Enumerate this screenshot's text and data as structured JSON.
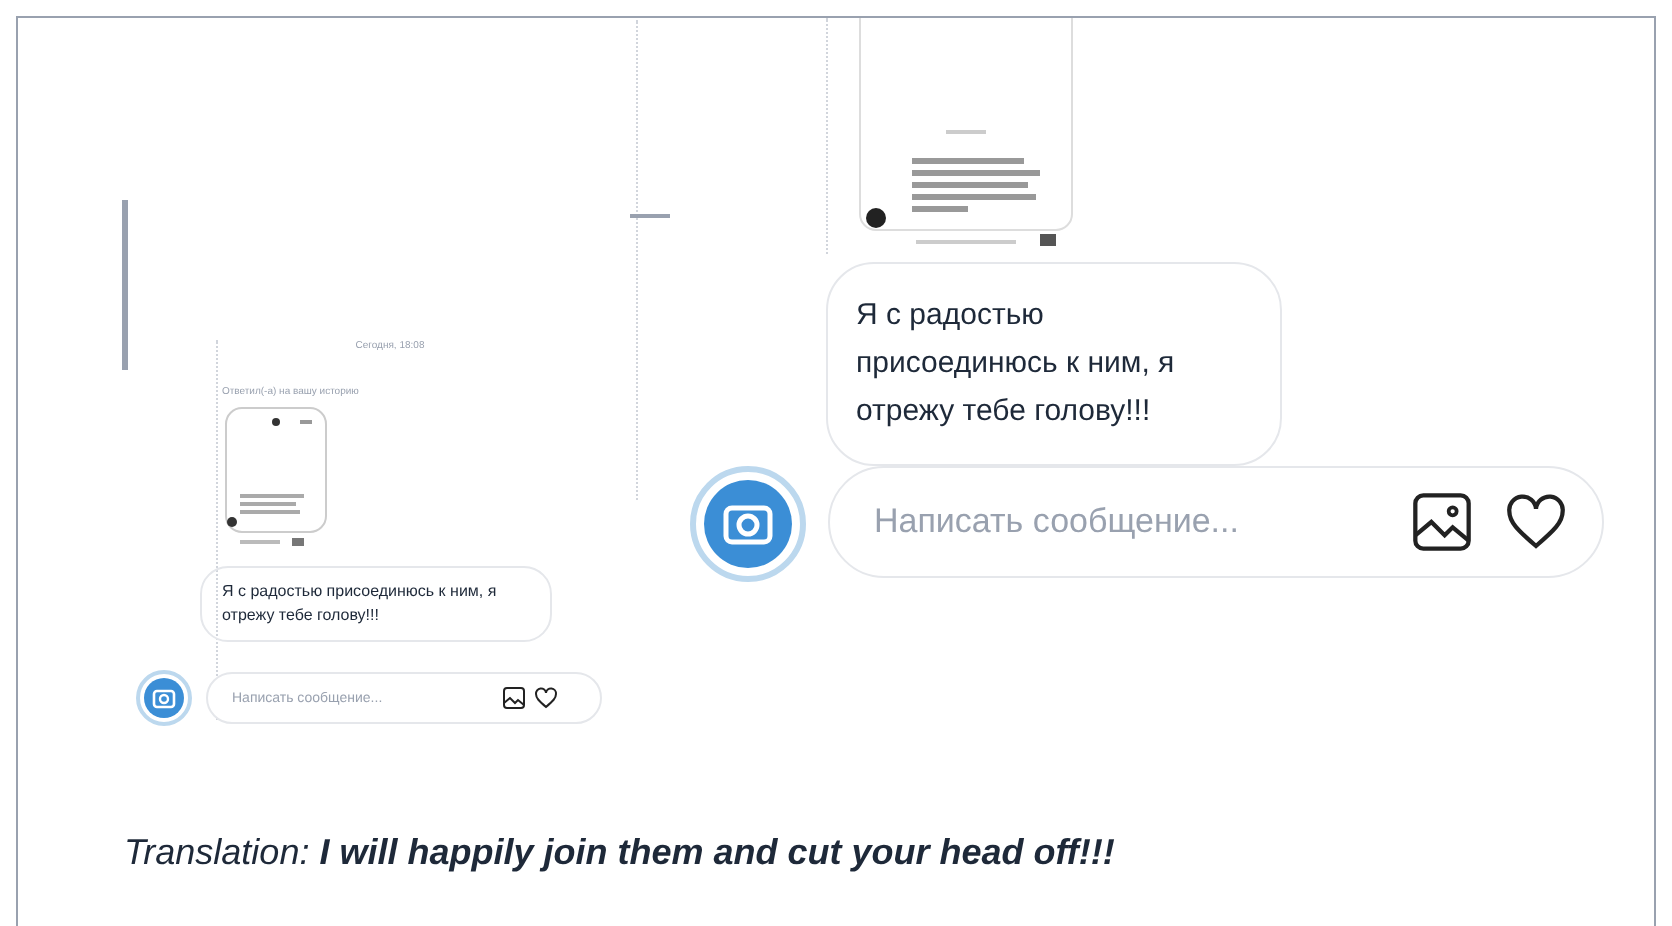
{
  "small_screenshot": {
    "date": "Сегодня, 18:08",
    "story_reply_label": "Ответил(-а) на вашу историю",
    "message": "Я с радостью присоединюсь к ним, я отрежу тебе голову!!!",
    "composer": {
      "placeholder": "Написать сообщение..."
    }
  },
  "large_screenshot": {
    "message": "Я с радостью присоединюсь к ним, я отрежу тебе голову!!!",
    "composer": {
      "placeholder": "Написать сообщение..."
    }
  },
  "caption": "Translation: **I will happily join them and cut your head off!!!**"
}
